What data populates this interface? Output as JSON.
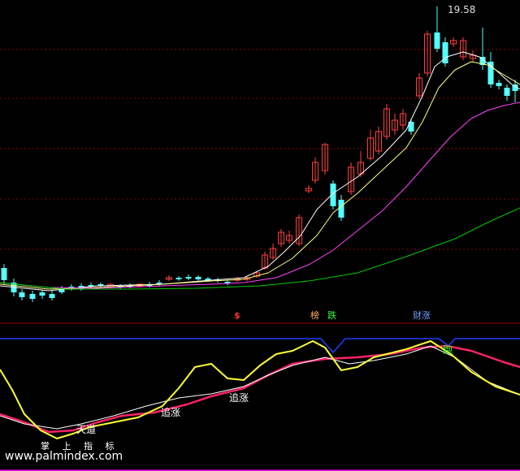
{
  "price_chart": {
    "high_label": "19.58",
    "colors": {
      "up": "#ff4040",
      "down": "#54ffff",
      "ma5": "#ffffff",
      "ma10": "#ffff7f",
      "ma20": "#ff44ff",
      "ma60": "#00cc00",
      "grid": "#8b0000",
      "zero_line": "#c0c0c0"
    }
  },
  "signals": {
    "dollar": "$",
    "bang": "榜",
    "die": "跌",
    "caizhang": "财涨"
  },
  "indicator": {
    "labels": {
      "tiandao": "天道",
      "zhuizhang_1": "追涨",
      "zhuizhang_2": "追涨",
      "pao": "跑"
    },
    "colors": {
      "fast": "#ffff33",
      "slow": "#ff2266",
      "mid": "#ffffff",
      "band": "#1f3fff"
    }
  },
  "footer": {
    "brand": "掌 上 指 标",
    "watermark": "www.palmindex.com"
  }
}
